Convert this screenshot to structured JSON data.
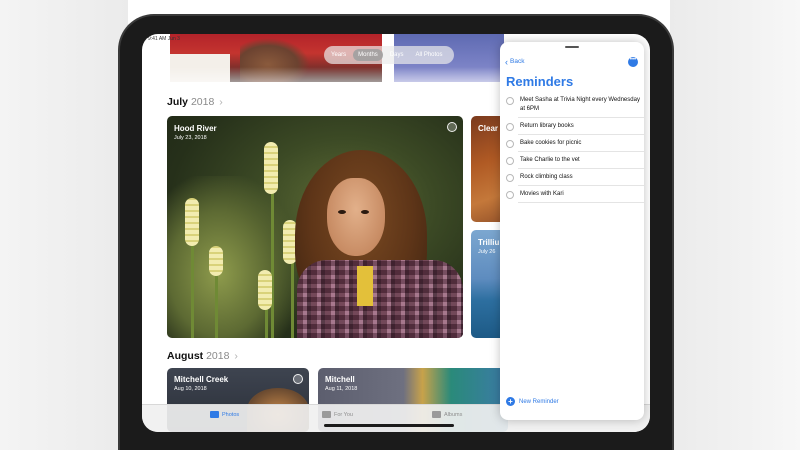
{
  "status_bar": {
    "time": "9:41 AM Jun 3"
  },
  "photos": {
    "segmented": [
      "Years",
      "Months",
      "Days",
      "All Photos"
    ],
    "selected_segment": "Months",
    "sections": [
      {
        "month": "July",
        "year": "2018",
        "chevron": "›"
      },
      {
        "month": "August",
        "year": "2018",
        "chevron": "›"
      }
    ],
    "cards": {
      "hood_river": {
        "title": "Hood River",
        "date": "July 23, 2018"
      },
      "clear_lake": {
        "title": "Clear"
      },
      "trillium": {
        "title": "Trilliu",
        "date": "July 26"
      },
      "mitchell_creek": {
        "title": "Mitchell Creek",
        "date": "Aug 10, 2018"
      },
      "mitchell": {
        "title": "Mitchell",
        "date": "Aug 11, 2018"
      }
    },
    "tabs": [
      {
        "label": "Photos",
        "icon": "photos-icon"
      },
      {
        "label": "For You",
        "icon": "for-you-icon"
      },
      {
        "label": "Albums",
        "icon": "albums-icon"
      }
    ]
  },
  "reminders": {
    "back_label": "Back",
    "title": "Reminders",
    "items": [
      "Meet Sasha at Trivia Night every Wednesday at 6PM",
      "Return library books",
      "Bake cookies for picnic",
      "Take Charlie to the vet",
      "Rock climbing class",
      "Movies with Kari"
    ],
    "new_label": "New Reminder"
  },
  "colors": {
    "accent": "#2f7ae5",
    "bezel": "#1b1b1b"
  }
}
